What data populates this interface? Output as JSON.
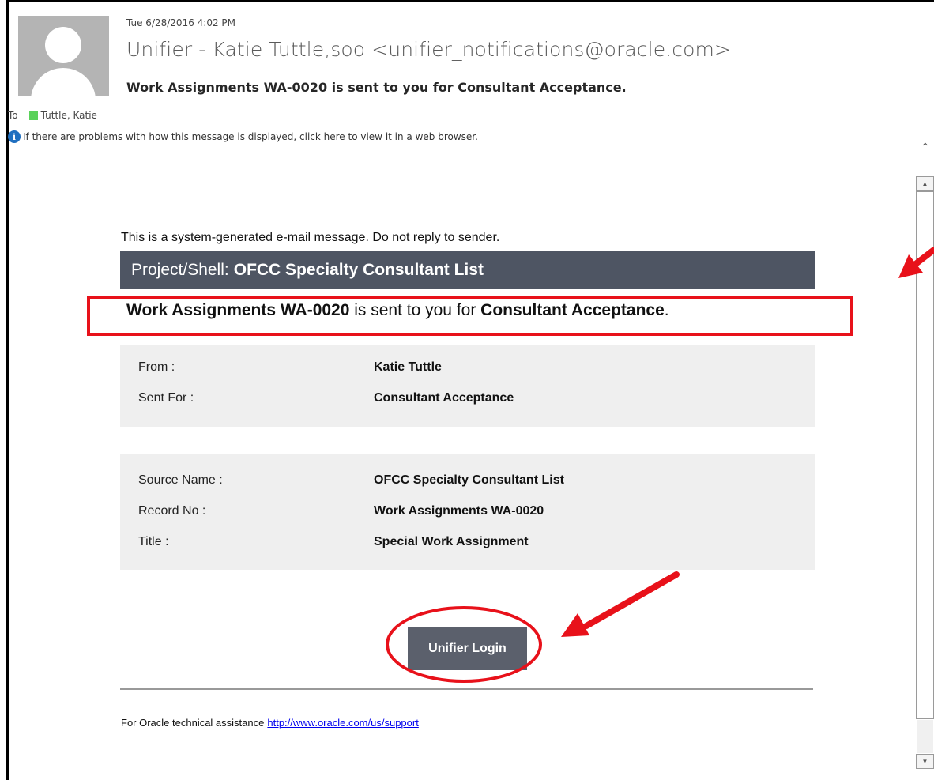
{
  "header": {
    "date": "Tue 6/28/2016 4:02 PM",
    "from": "Unifier - Katie Tuttle,soo <unifier_notifications@oracle.com>",
    "subject": "Work Assignments WA-0020 is sent to you for Consultant Acceptance.",
    "to_label": "To",
    "to_name": "Tuttle, Katie",
    "info_text": "If there are problems with how this message is displayed, click here to view it in a web browser."
  },
  "body": {
    "system_message": "This is a system-generated e-mail message. Do not reply to sender.",
    "shell_label": "Project/Shell:",
    "shell_name": "OFCC Specialty Consultant List",
    "wa_record": "Work Assignments WA-0020",
    "wa_middle": " is sent to you for ",
    "wa_step": "Consultant Acceptance",
    "wa_end": ".",
    "details1": [
      {
        "label": "From :",
        "value": "Katie Tuttle"
      },
      {
        "label": "Sent For :",
        "value": "Consultant Acceptance"
      }
    ],
    "details2": [
      {
        "label": "Source Name :",
        "value": "OFCC Specialty Consultant List"
      },
      {
        "label": "Record No :",
        "value": "Work Assignments WA-0020"
      },
      {
        "label": "Title :",
        "value": "Special Work Assignment"
      }
    ],
    "login_button": "Unifier Login",
    "footer_text": "For Oracle technical assistance",
    "footer_link": "http://www.oracle.com/us/support"
  },
  "colors": {
    "annotation_red": "#e8111a",
    "shell_bar_bg": "#4e5563",
    "button_bg": "#5b606c",
    "detail_block_bg": "#efefef",
    "presence_green": "#5bd25b",
    "info_blue": "#1f6fc0"
  },
  "icons": {
    "avatar": "default-avatar-icon",
    "info": "info-icon",
    "collapse": "chevron-up-icon",
    "presence": "presence-square-icon"
  }
}
